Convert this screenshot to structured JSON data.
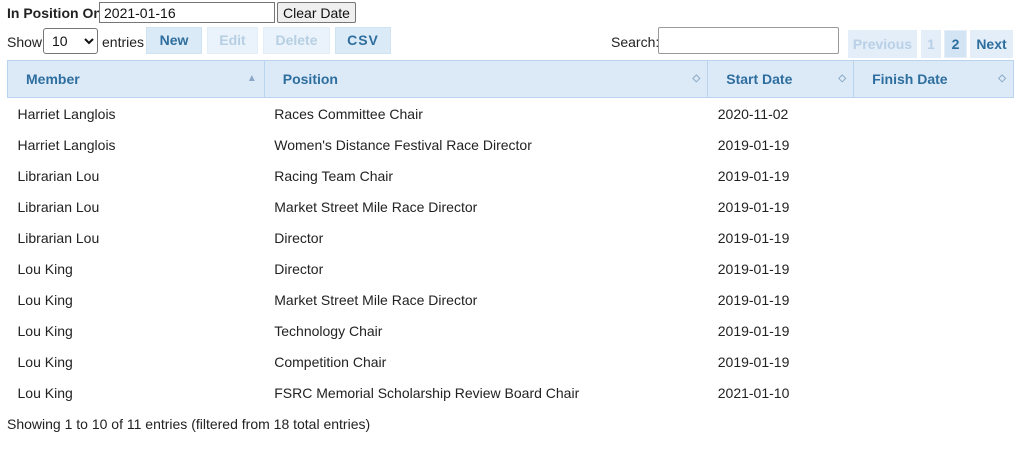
{
  "filter": {
    "label": "In Position On",
    "date_value": "2021-01-16",
    "clear_label": "Clear Date"
  },
  "length": {
    "show_label": "Show",
    "selected": "10",
    "entries_label": "entries"
  },
  "toolbar": {
    "new_label": "New",
    "edit_label": "Edit",
    "delete_label": "Delete",
    "csv_label": "CSV"
  },
  "search": {
    "label": "Search:",
    "value": ""
  },
  "pagination": {
    "previous_label": "Previous",
    "pages": [
      "1",
      "2"
    ],
    "current_page": "2",
    "next_label": "Next"
  },
  "table": {
    "columns": [
      "Member",
      "Position",
      "Start Date",
      "Finish Date"
    ],
    "rows": [
      [
        "Harriet Langlois",
        "Races Committee Chair",
        "2020-11-02",
        ""
      ],
      [
        "Harriet Langlois",
        "Women's Distance Festival Race Director",
        "2019-01-19",
        ""
      ],
      [
        "Librarian Lou",
        "Racing Team Chair",
        "2019-01-19",
        ""
      ],
      [
        "Librarian Lou",
        "Market Street Mile Race Director",
        "2019-01-19",
        ""
      ],
      [
        "Librarian Lou",
        "Director",
        "2019-01-19",
        ""
      ],
      [
        "Lou King",
        "Director",
        "2019-01-19",
        ""
      ],
      [
        "Lou King",
        "Market Street Mile Race Director",
        "2019-01-19",
        ""
      ],
      [
        "Lou King",
        "Technology Chair",
        "2019-01-19",
        ""
      ],
      [
        "Lou King",
        "Competition Chair",
        "2019-01-19",
        ""
      ],
      [
        "Lou King",
        "FSRC Memorial Scholarship Review Board Chair",
        "2021-01-10",
        ""
      ]
    ]
  },
  "info": "Showing 1 to 10 of 11 entries (filtered from 18 total entries)",
  "colors": {
    "header_bg": "#dceaf8",
    "accent_text": "#2e6e9e",
    "button_bg": "#dbeaf7"
  }
}
